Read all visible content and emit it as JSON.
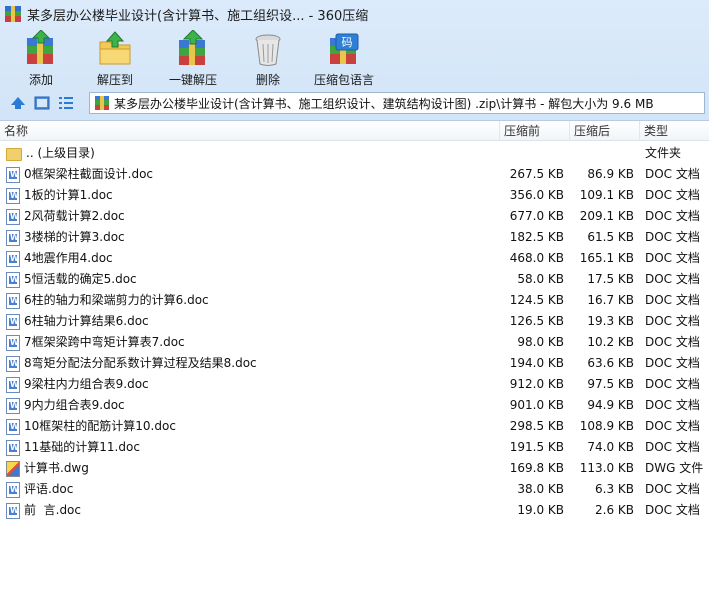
{
  "window": {
    "title": "某多层办公楼毕业设计(含计算书、施工组织设... - 360压缩"
  },
  "toolbar": {
    "items": [
      {
        "label": "添加",
        "icon": "add-archive-icon"
      },
      {
        "label": "解压到",
        "icon": "extract-to-icon"
      },
      {
        "label": "一键解压",
        "icon": "one-click-extract-icon"
      },
      {
        "label": "删除",
        "icon": "trash-bin-icon"
      },
      {
        "label": "压缩包语言",
        "icon": "archive-language-icon"
      }
    ]
  },
  "addressbar": {
    "path": "某多层办公楼毕业设计(含计算书、施工组织设计、建筑结构设计图) .zip\\计算书 - 解包大小为 9.6 MB"
  },
  "columns": {
    "name": "名称",
    "size": "压缩前",
    "packed": "压缩后",
    "type": "类型"
  },
  "files": [
    {
      "name": ".. (上级目录)",
      "size": "",
      "packed": "",
      "type": "文件夹",
      "kind": "folder"
    },
    {
      "name": "0框架梁柱截面设计.doc",
      "size": "267.5 KB",
      "packed": "86.9 KB",
      "type": "DOC 文档",
      "kind": "doc"
    },
    {
      "name": "1板的计算1.doc",
      "size": "356.0 KB",
      "packed": "109.1 KB",
      "type": "DOC 文档",
      "kind": "doc"
    },
    {
      "name": "2风荷载计算2.doc",
      "size": "677.0 KB",
      "packed": "209.1 KB",
      "type": "DOC 文档",
      "kind": "doc"
    },
    {
      "name": "3楼梯的计算3.doc",
      "size": "182.5 KB",
      "packed": "61.5 KB",
      "type": "DOC 文档",
      "kind": "doc"
    },
    {
      "name": "4地震作用4.doc",
      "size": "468.0 KB",
      "packed": "165.1 KB",
      "type": "DOC 文档",
      "kind": "doc"
    },
    {
      "name": "5恒活载的确定5.doc",
      "size": "58.0 KB",
      "packed": "17.5 KB",
      "type": "DOC 文档",
      "kind": "doc"
    },
    {
      "name": "6柱的轴力和梁端剪力的计算6.doc",
      "size": "124.5 KB",
      "packed": "16.7 KB",
      "type": "DOC 文档",
      "kind": "doc"
    },
    {
      "name": "6柱轴力计算结果6.doc",
      "size": "126.5 KB",
      "packed": "19.3 KB",
      "type": "DOC 文档",
      "kind": "doc"
    },
    {
      "name": "7框架梁跨中弯矩计算表7.doc",
      "size": "98.0 KB",
      "packed": "10.2 KB",
      "type": "DOC 文档",
      "kind": "doc"
    },
    {
      "name": "8弯矩分配法分配系数计算过程及结果8.doc",
      "size": "194.0 KB",
      "packed": "63.6 KB",
      "type": "DOC 文档",
      "kind": "doc"
    },
    {
      "name": "9梁柱内力组合表9.doc",
      "size": "912.0 KB",
      "packed": "97.5 KB",
      "type": "DOC 文档",
      "kind": "doc"
    },
    {
      "name": "9内力组合表9.doc",
      "size": "901.0 KB",
      "packed": "94.9 KB",
      "type": "DOC 文档",
      "kind": "doc"
    },
    {
      "name": "10框架柱的配筋计算10.doc",
      "size": "298.5 KB",
      "packed": "108.9 KB",
      "type": "DOC 文档",
      "kind": "doc"
    },
    {
      "name": "11基础的计算11.doc",
      "size": "191.5 KB",
      "packed": "74.0 KB",
      "type": "DOC 文档",
      "kind": "doc"
    },
    {
      "name": "计算书.dwg",
      "size": "169.8 KB",
      "packed": "113.0 KB",
      "type": "DWG 文件",
      "kind": "dwg"
    },
    {
      "name": "评语.doc",
      "size": "38.0 KB",
      "packed": "6.3 KB",
      "type": "DOC 文档",
      "kind": "doc"
    },
    {
      "name": "前  言.doc",
      "size": "19.0 KB",
      "packed": "2.6 KB",
      "type": "DOC 文档",
      "kind": "doc"
    }
  ],
  "colors": {
    "chrome": "#d2e4f7",
    "list_bg": "#ffffff",
    "accent_blue": "#2e6fd0"
  }
}
